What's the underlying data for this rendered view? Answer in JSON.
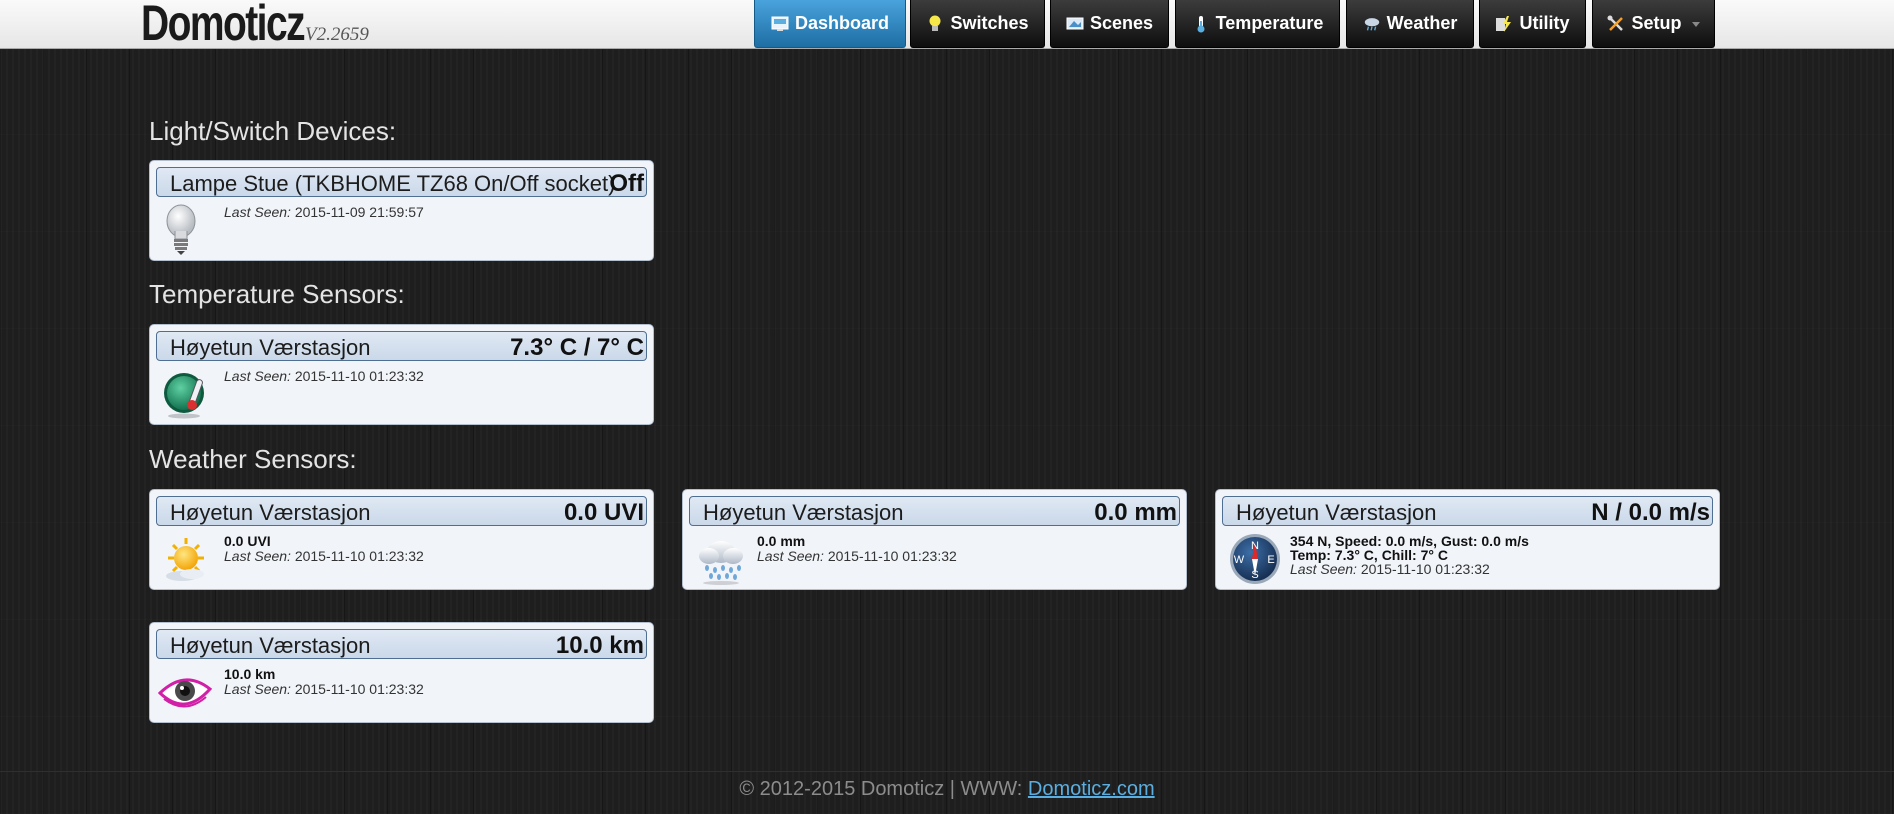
{
  "header": {
    "brand": "Domoticz",
    "version": "V2.2659",
    "nav": [
      {
        "label": "Dashboard",
        "icon": "dashboard-icon"
      },
      {
        "label": "Switches",
        "icon": "lightbulb-icon"
      },
      {
        "label": "Scenes",
        "icon": "scenes-icon"
      },
      {
        "label": "Temperature",
        "icon": "thermometer-icon"
      },
      {
        "label": "Weather",
        "icon": "weather-icon"
      },
      {
        "label": "Utility",
        "icon": "utility-icon"
      },
      {
        "label": "Setup",
        "icon": "setup-icon"
      }
    ]
  },
  "sections": {
    "light": {
      "title": "Light/Switch Devices:",
      "devices": [
        {
          "name": "Lampe Stue (TKBHOME TZ68 On/Off socket)",
          "value": "Off",
          "detail": "",
          "last_seen_label": "Last Seen:",
          "last_seen": "2015-11-09 21:59:57",
          "icon": "lightbulb-icon"
        }
      ]
    },
    "temperature": {
      "title": "Temperature Sensors:",
      "devices": [
        {
          "name": "Høyetun Værstasjon",
          "value": "7.3° C / 7° C",
          "detail": "",
          "last_seen_label": "Last Seen:",
          "last_seen": "2015-11-10 01:23:32",
          "icon": "thermometer-gauge-icon"
        }
      ]
    },
    "weather": {
      "title": "Weather Sensors:",
      "devices": [
        {
          "name": "Høyetun Værstasjon",
          "value": "0.0 UVI",
          "detail": "0.0 UVI",
          "last_seen_label": "Last Seen:",
          "last_seen": "2015-11-10 01:23:32",
          "icon": "sun-icon"
        },
        {
          "name": "Høyetun Værstasjon",
          "value": "0.0 mm",
          "detail": "0.0 mm",
          "last_seen_label": "Last Seen:",
          "last_seen": "2015-11-10 01:23:32",
          "icon": "rain-cloud-icon"
        },
        {
          "name": "Høyetun Værstasjon",
          "value": "N / 0.0 m/s",
          "detail": "354 N, Speed: 0.0 m/s, Gust: 0.0 m/s",
          "detail2": "Temp: 7.3° C, Chill: 7° C",
          "last_seen_label": "Last Seen:",
          "last_seen": "2015-11-10 01:23:32",
          "icon": "compass-icon",
          "compass": {
            "n": "N",
            "e": "E",
            "s": "S",
            "w": "W"
          }
        },
        {
          "name": "Høyetun Værstasjon",
          "value": "10.0 km",
          "detail": "10.0 km",
          "last_seen_label": "Last Seen:",
          "last_seen": "2015-11-10 01:23:32",
          "icon": "eye-icon"
        }
      ]
    }
  },
  "footer": {
    "text": "© 2012-2015 Domoticz | WWW: ",
    "link": "Domoticz.com"
  },
  "colors": {
    "active_nav": "#2e8bc9",
    "card_bg": "#f1f4f9",
    "card_header": "#cad8e9",
    "link": "#5aaee0"
  }
}
